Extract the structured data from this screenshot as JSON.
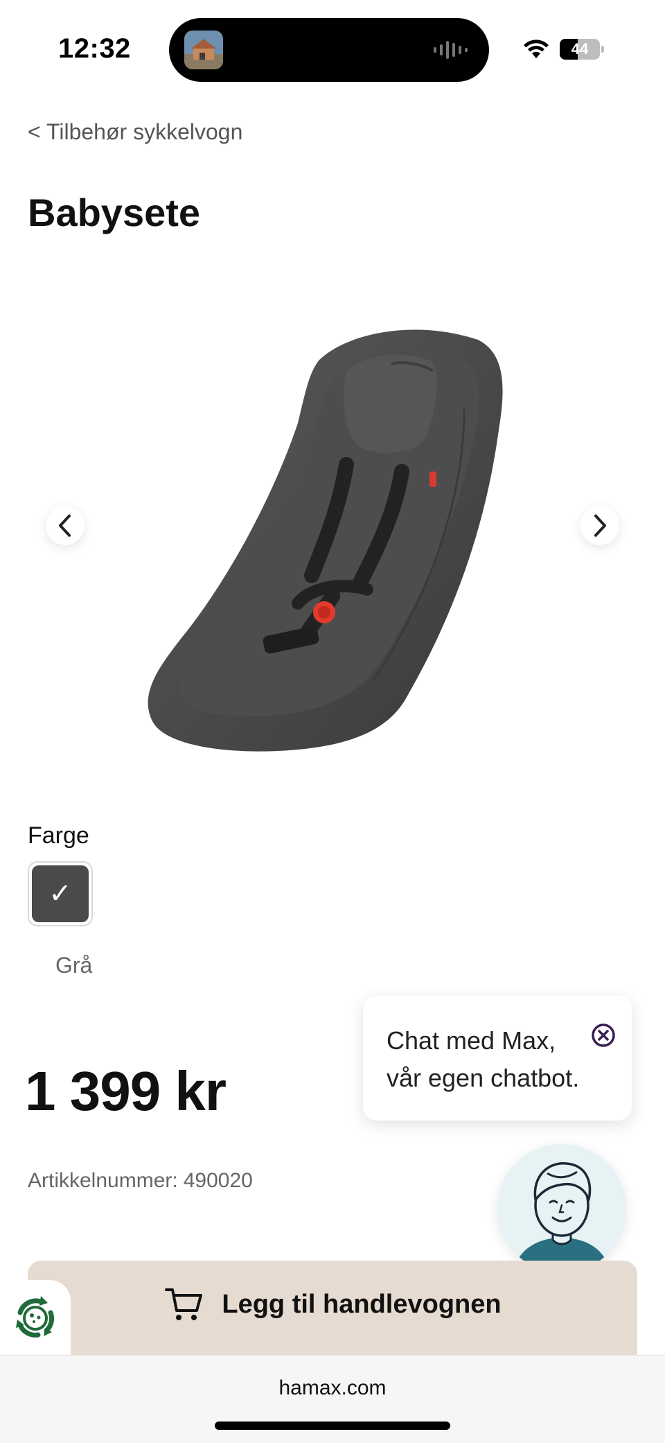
{
  "status_bar": {
    "time": "12:32",
    "battery_level": "44",
    "battery_fraction": 0.44
  },
  "breadcrumb": "< Tilbehør sykkelvogn",
  "product": {
    "title": "Babysete",
    "color_label": "Farge",
    "selected_color": {
      "name": "Grå",
      "hex": "#4a4a4a",
      "check": "✓"
    },
    "price": "1 399 kr",
    "sku_label": "Artikkelnummer:",
    "sku_value": "490020"
  },
  "chat": {
    "line1": "Chat med Max,",
    "line2": "vår egen chatbot."
  },
  "cart": {
    "label": "Legg til handlevognen"
  },
  "browser": {
    "domain": "hamax.com"
  },
  "colors": {
    "cart_bg": "#e6dbd0",
    "eco_green": "#1f6b3a",
    "avatar_shirt": "#2b6f82"
  },
  "icons": {
    "prev": "chevron-left-icon",
    "next": "chevron-right-icon",
    "close": "close-circle-icon",
    "cart": "shopping-cart-icon",
    "eco": "recycle-badge-icon"
  }
}
